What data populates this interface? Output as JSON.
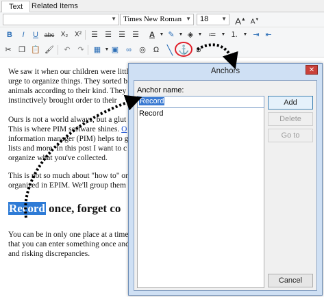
{
  "tabs": [
    {
      "label": "Text"
    },
    {
      "label": "Related Items"
    }
  ],
  "toolbar": {
    "font": "Times New Roman",
    "size": "18",
    "bold": "B",
    "italic": "I",
    "underline": "U",
    "strike": "abc",
    "subscript": "X₂",
    "superscript": "X²",
    "grow_font": "A",
    "shrink_font": "A",
    "symbol": "Ω"
  },
  "document": {
    "para1": [
      "We saw it when our children were little",
      "urge to organize things. They sorted b",
      "animals according to their kind. They c",
      "instinctively brought order to their"
    ],
    "para2": [
      "Ours is not a world always, but a glut",
      "This is where PIM software shines.",
      "information manager (PIM) helps to g",
      "lists and more. In this post I want to c",
      "organize what you've collected."
    ],
    "para2_link": "O",
    "para3": [
      "This is not so much about \"how to\" org",
      "organized in EPIM. We'll group them"
    ],
    "heading_selected": "Record",
    "heading_rest": " once, forget co",
    "para4": [
      "You can be in only one place at a time",
      "that you can enter something once and",
      "and risking discrepancies."
    ]
  },
  "dialog": {
    "title": "Anchors",
    "close": "✕",
    "anchor_name_label": "Anchor name:",
    "anchor_name_value": "Record",
    "list_items": [
      "Record"
    ],
    "buttons": {
      "add": "Add",
      "delete": "Delete",
      "goto": "Go to",
      "cancel": "Cancel"
    }
  },
  "colors": {
    "dialog_frame": "#cfe0f4",
    "selection": "#2e7bd6",
    "highlight_ring": "#e0202a"
  }
}
